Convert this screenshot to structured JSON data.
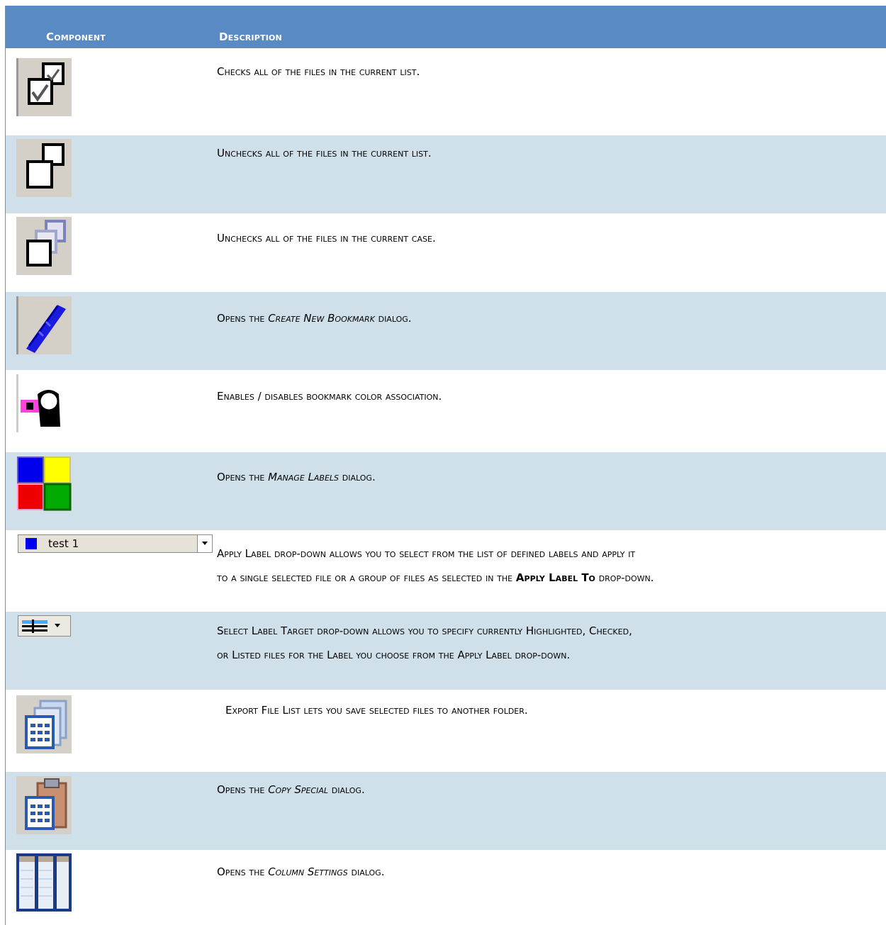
{
  "header": {
    "component": "Component",
    "description": "Description"
  },
  "rows": [
    {
      "icon": "check-all-icon",
      "desc": "Checks all of the files in the current list."
    },
    {
      "icon": "uncheck-all-list-icon",
      "desc": "Unchecks all of the files in the current list."
    },
    {
      "icon": "uncheck-all-case-icon",
      "desc": "Unchecks all of the files in the current case."
    },
    {
      "icon": "bookmark-icon",
      "pre": "Opens the ",
      "em": "Create New Bookmark",
      "post": " dialog."
    },
    {
      "icon": "bookmark-color-icon",
      "desc": "Enables / disables bookmark color association."
    },
    {
      "icon": "manage-labels-icon",
      "pre": "Opens the ",
      "em": "Manage Labels",
      "post": " dialog."
    },
    {
      "icon": "apply-label-dropdown",
      "dropdown_value": "test 1",
      "line1": "Apply Label drop-down allows you to select from the list of defined labels and apply it",
      "line2_pre": "to a single selected file or a group of files as selected in the ",
      "line2_bold": "Apply Label To",
      "line2_post": " drop-down."
    },
    {
      "icon": "label-target-icon",
      "line1": "Select Label Target drop-down allows you to specify currently Highlighted, Checked,",
      "line2": "or Listed files for the Label you choose from the Apply Label drop-down."
    },
    {
      "icon": "export-file-list-icon",
      "desc": "Export File List lets you save selected files to another folder."
    },
    {
      "icon": "copy-special-icon",
      "pre": "Opens the ",
      "em": "Copy Special",
      "post": " dialog."
    },
    {
      "icon": "column-settings-icon",
      "pre": "Opens the ",
      "em": "Column Settings",
      "post": " dialog."
    }
  ]
}
